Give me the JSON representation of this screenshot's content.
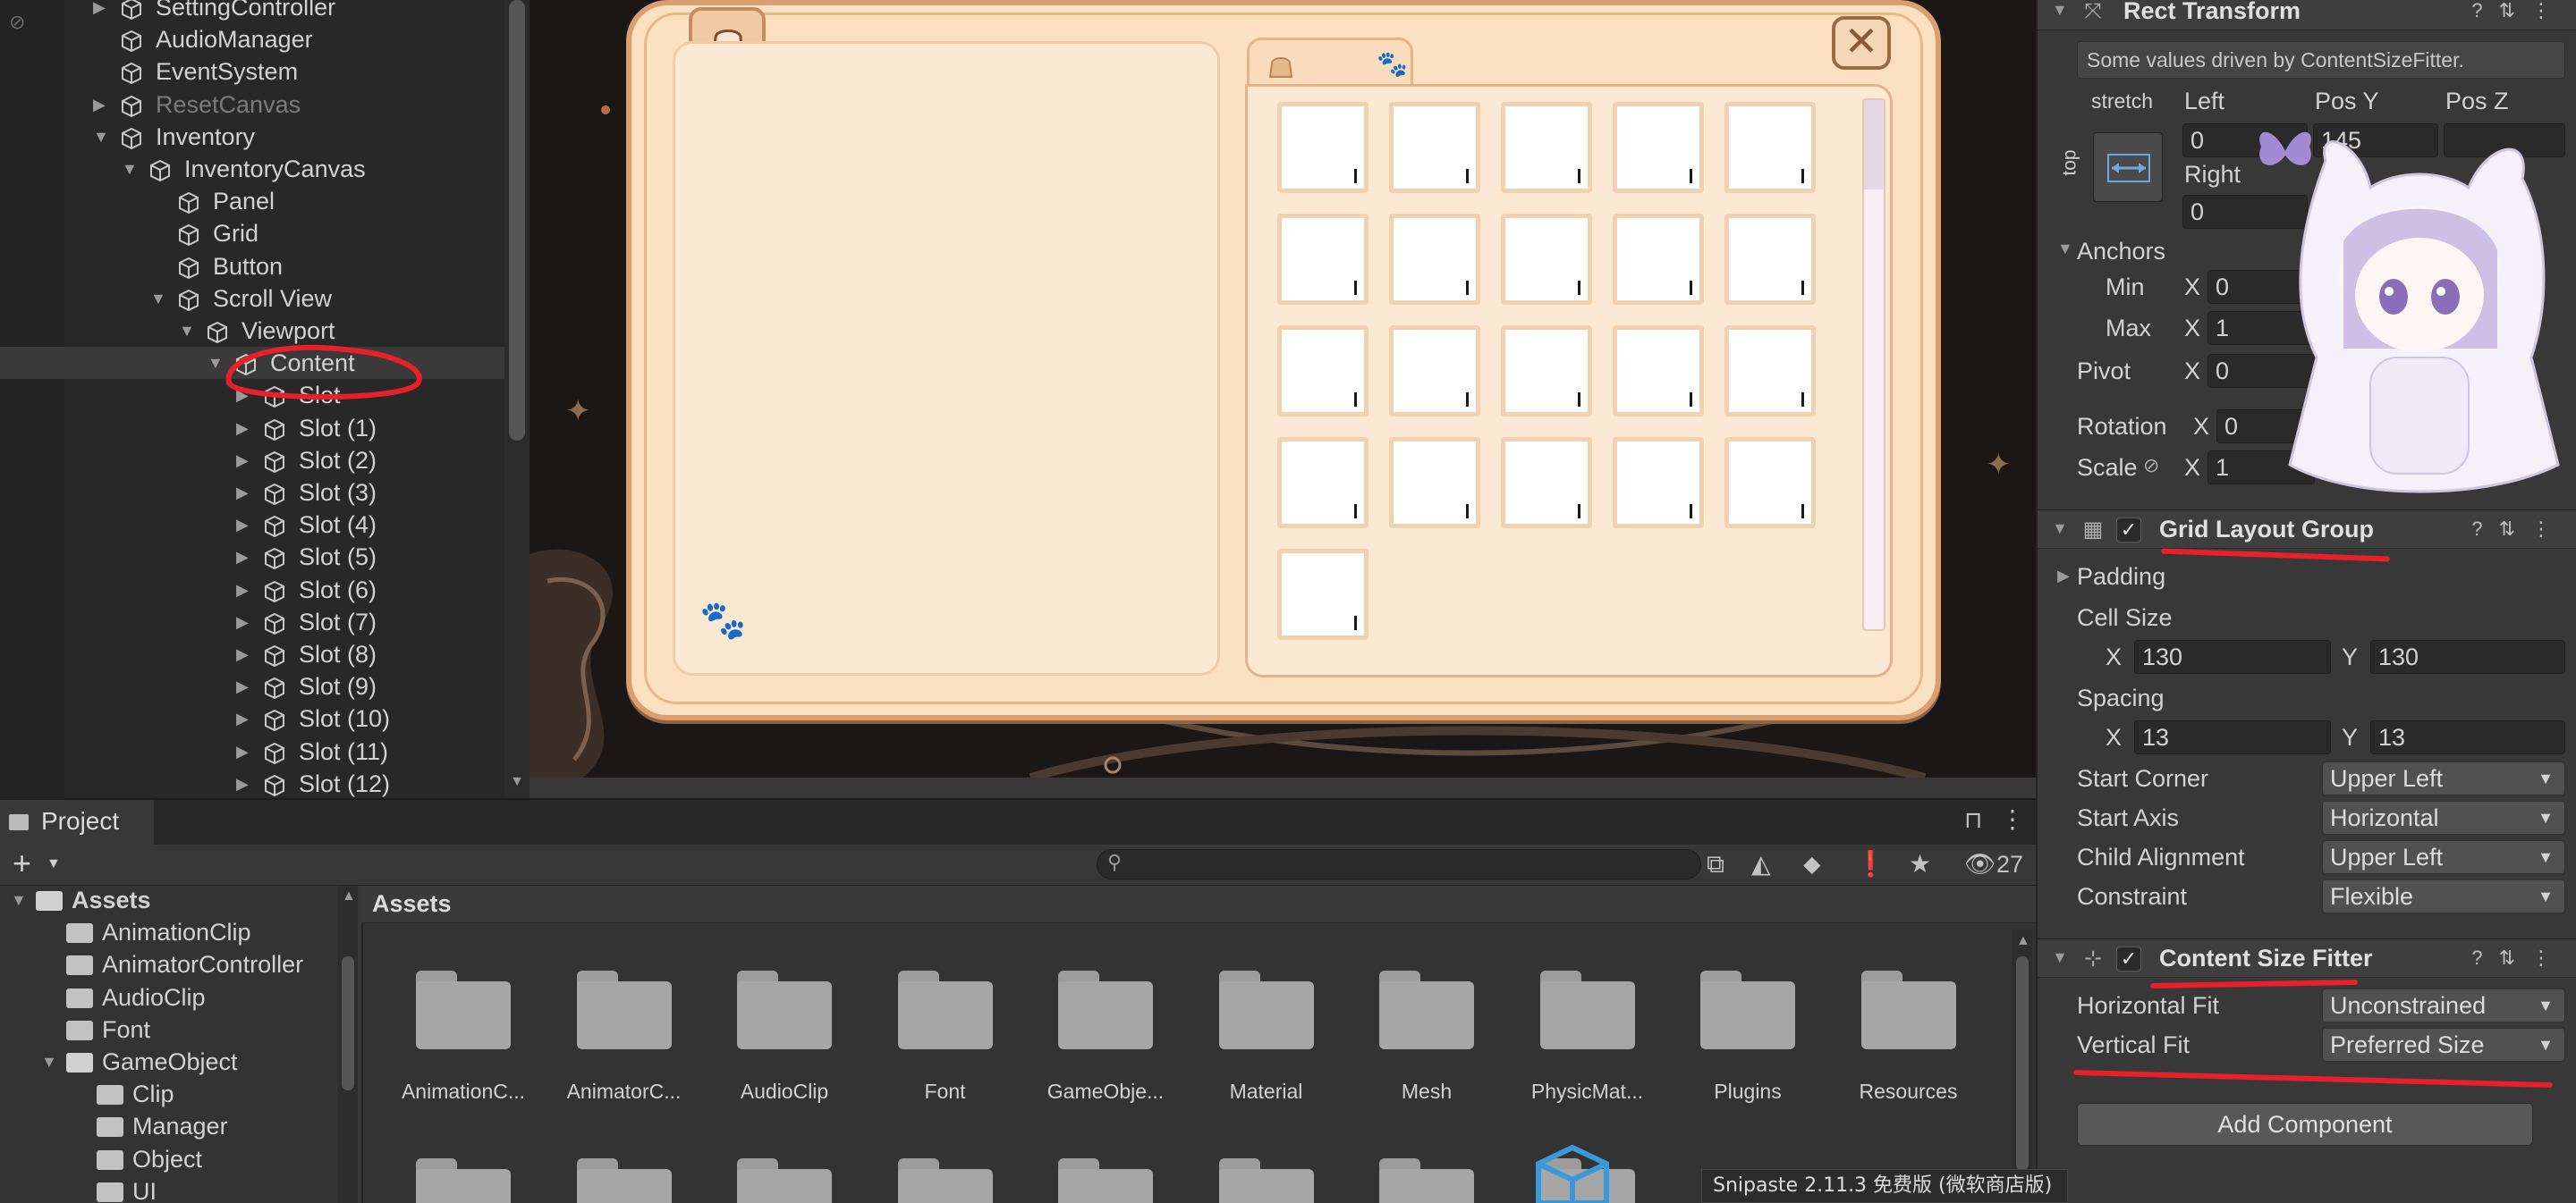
{
  "hierarchy": {
    "rows": [
      {
        "label": "SettingController",
        "depth": 0,
        "arrow": "▶",
        "dim": false
      },
      {
        "label": "AudioManager",
        "depth": 0,
        "arrow": "",
        "dim": false
      },
      {
        "label": "EventSystem",
        "depth": 0,
        "arrow": "",
        "dim": false
      },
      {
        "label": "ResetCanvas",
        "depth": 0,
        "arrow": "▶",
        "dim": true
      },
      {
        "label": "Inventory",
        "depth": 0,
        "arrow": "▼",
        "dim": false
      },
      {
        "label": "InventoryCanvas",
        "depth": 1,
        "arrow": "▼",
        "dim": false
      },
      {
        "label": "Panel",
        "depth": 2,
        "arrow": "",
        "dim": false
      },
      {
        "label": "Grid",
        "depth": 2,
        "arrow": "",
        "dim": false
      },
      {
        "label": "Button",
        "depth": 2,
        "arrow": "",
        "dim": false
      },
      {
        "label": "Scroll View",
        "depth": 2,
        "arrow": "▼",
        "dim": false
      },
      {
        "label": "Viewport",
        "depth": 3,
        "arrow": "▼",
        "dim": false
      },
      {
        "label": "Content",
        "depth": 4,
        "arrow": "▼",
        "dim": false,
        "selected": true
      },
      {
        "label": "Slot",
        "depth": 5,
        "arrow": "▶",
        "dim": false
      },
      {
        "label": "Slot (1)",
        "depth": 5,
        "arrow": "▶",
        "dim": false
      },
      {
        "label": "Slot (2)",
        "depth": 5,
        "arrow": "▶",
        "dim": false
      },
      {
        "label": "Slot (3)",
        "depth": 5,
        "arrow": "▶",
        "dim": false
      },
      {
        "label": "Slot (4)",
        "depth": 5,
        "arrow": "▶",
        "dim": false
      },
      {
        "label": "Slot (5)",
        "depth": 5,
        "arrow": "▶",
        "dim": false
      },
      {
        "label": "Slot (6)",
        "depth": 5,
        "arrow": "▶",
        "dim": false
      },
      {
        "label": "Slot (7)",
        "depth": 5,
        "arrow": "▶",
        "dim": false
      },
      {
        "label": "Slot (8)",
        "depth": 5,
        "arrow": "▶",
        "dim": false
      },
      {
        "label": "Slot (9)",
        "depth": 5,
        "arrow": "▶",
        "dim": false
      },
      {
        "label": "Slot (10)",
        "depth": 5,
        "arrow": "▶",
        "dim": false
      },
      {
        "label": "Slot (11)",
        "depth": 5,
        "arrow": "▶",
        "dim": false
      },
      {
        "label": "Slot (12)",
        "depth": 5,
        "arrow": "▶",
        "dim": false
      }
    ]
  },
  "scene": {
    "slot_count": 21,
    "close_glyph": "✕"
  },
  "inspector": {
    "rect_transform": {
      "title": "Rect Transform",
      "note": "Some values driven by ContentSizeFitter.",
      "anchor_mode": "stretch",
      "anchor_side": "top",
      "left_label": "Left",
      "left_value": "0",
      "posy_label": "Pos Y",
      "posy_value": "145",
      "posz_label": "Pos Z",
      "right_label": "Right",
      "right_value": "0",
      "anchors_label": "Anchors",
      "min_label": "Min",
      "min_x": "0",
      "max_label": "Max",
      "max_x": "1",
      "pivot_label": "Pivot",
      "pivot_x": "0",
      "rotation_label": "Rotation",
      "rotation_x": "0",
      "scale_label": "Scale",
      "scale_x": "1",
      "axis_x": "X"
    },
    "grid_layout": {
      "title": "Grid Layout Group",
      "padding_label": "Padding",
      "cell_size_label": "Cell Size",
      "cell_x": "130",
      "cell_y": "130",
      "spacing_label": "Spacing",
      "spacing_x": "13",
      "spacing_y": "13",
      "axis_x": "X",
      "axis_y": "Y",
      "start_corner_label": "Start Corner",
      "start_corner": "Upper Left",
      "start_axis_label": "Start Axis",
      "start_axis": "Horizontal",
      "child_alignment_label": "Child Alignment",
      "child_alignment": "Upper Left",
      "constraint_label": "Constraint",
      "constraint": "Flexible"
    },
    "content_size_fitter": {
      "title": "Content Size Fitter",
      "horizontal_fit_label": "Horizontal Fit",
      "horizontal_fit": "Unconstrained",
      "vertical_fit_label": "Vertical Fit",
      "vertical_fit": "Preferred Size"
    },
    "add_component": "Add Component",
    "annotation_color": "#e8202a"
  },
  "project": {
    "tab_label": "Project",
    "hidden_count": "27",
    "tree": [
      {
        "label": "Assets",
        "depth": 0,
        "arrow": "▼",
        "bold": true
      },
      {
        "label": "AnimationClip",
        "depth": 1,
        "arrow": ""
      },
      {
        "label": "AnimatorController",
        "depth": 1,
        "arrow": ""
      },
      {
        "label": "AudioClip",
        "depth": 1,
        "arrow": ""
      },
      {
        "label": "Font",
        "depth": 1,
        "arrow": ""
      },
      {
        "label": "GameObject",
        "depth": 1,
        "arrow": "▼"
      },
      {
        "label": "Clip",
        "depth": 2,
        "arrow": ""
      },
      {
        "label": "Manager",
        "depth": 2,
        "arrow": ""
      },
      {
        "label": "Object",
        "depth": 2,
        "arrow": ""
      },
      {
        "label": "UI",
        "depth": 2,
        "arrow": ""
      }
    ],
    "breadcrumb": "Assets",
    "folders": [
      "AnimationC...",
      "AnimatorC...",
      "AudioClip",
      "Font",
      "GameObje...",
      "Material",
      "Mesh",
      "PhysicMat...",
      "Plugins",
      "Resources"
    ]
  },
  "overlay": {
    "snipaste": "Snipaste 2.11.3 免费版 (微软商店版)"
  }
}
